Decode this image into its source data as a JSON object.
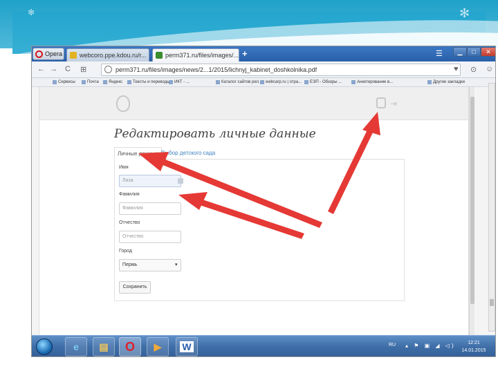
{
  "browser": {
    "app_name": "Opera",
    "tabs": [
      {
        "label": "webcoro.ppe.kdou.ru/r...",
        "active": false
      },
      {
        "label": "perm371.ru/files/images/...",
        "active": true
      }
    ],
    "url": "perm371.ru/files/images/news/2...1/2015/lichnyj_kabinet_doshkolnika.pdf",
    "bookmarks": [
      "Сервисы",
      "Почта",
      "Яндекс",
      "Тексты и переводы...",
      "ИКТ - ...",
      "Каталог сайтов рел...",
      "webcarp.ru | отра...",
      "ЕЭП - Обзоры ...",
      "Анкетирование в...",
      "Другие закладки"
    ]
  },
  "page": {
    "title": "Редактировать личные данные",
    "tabs": {
      "personal": "Личные данные",
      "kindergarten": "Выбор детского сада"
    },
    "form": {
      "name_label": "Имя",
      "name_value": "Лиза",
      "surname_label": "Фамилия",
      "surname_placeholder": "Фамилия",
      "patronymic_label": "Отчество",
      "patronymic_placeholder": "Отчество",
      "city_label": "Город",
      "city_value": "Пермь",
      "save_label": "Сохранить"
    }
  },
  "taskbar": {
    "lang": "RU",
    "time": "12:21",
    "date": "14.01.2015"
  },
  "colors": {
    "slide_accent": "#23a6cf",
    "arrow": "#e53935",
    "link": "#3d7fbf",
    "taskbar": "#3f6ea8"
  }
}
